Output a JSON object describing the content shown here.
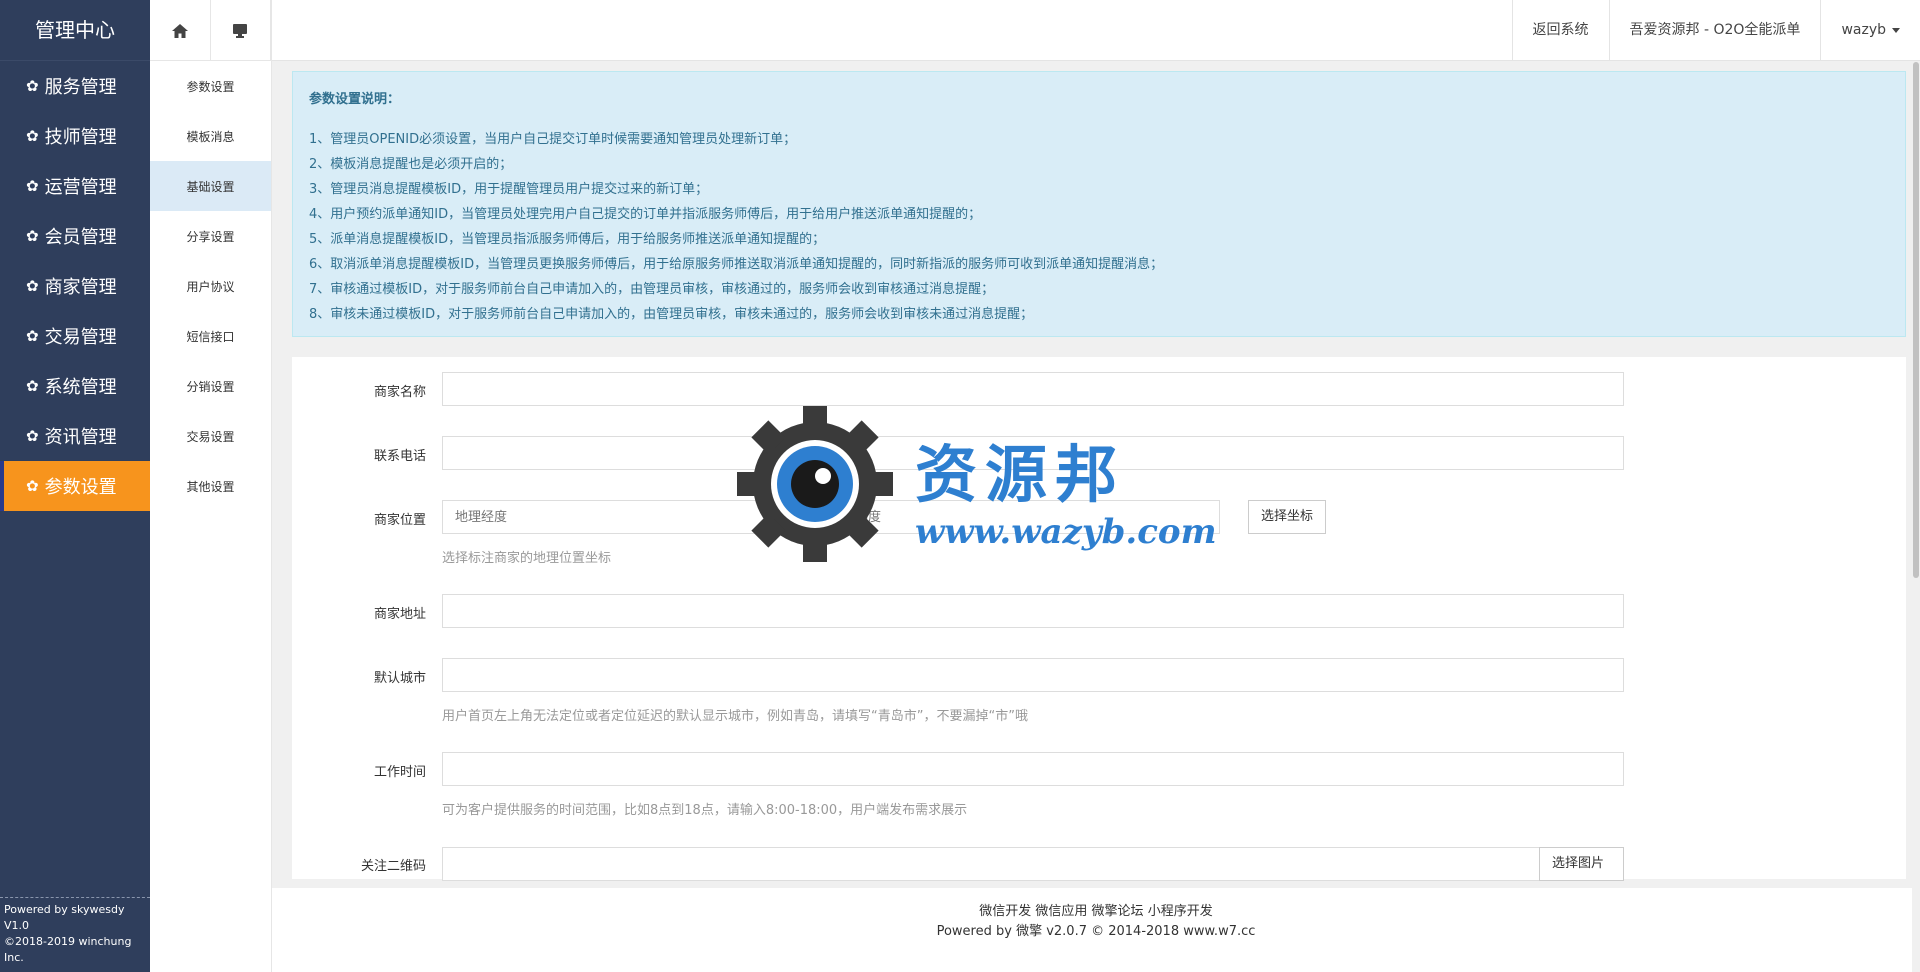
{
  "sidebar": {
    "brand": "管理中心",
    "items": [
      {
        "label": "服务管理"
      },
      {
        "label": "技师管理"
      },
      {
        "label": "运营管理"
      },
      {
        "label": "会员管理"
      },
      {
        "label": "商家管理"
      },
      {
        "label": "交易管理"
      },
      {
        "label": "系统管理"
      },
      {
        "label": "资讯管理"
      },
      {
        "label": "参数设置",
        "active": true
      }
    ],
    "powered_line1": "Powered by skywesdy V1.0",
    "powered_line2": "©2018-2019 winchung Inc."
  },
  "subnav": {
    "items": [
      {
        "label": "参数设置"
      },
      {
        "label": "模板消息"
      },
      {
        "label": "基础设置",
        "active": true
      },
      {
        "label": "分享设置"
      },
      {
        "label": "用户协议"
      },
      {
        "label": "短信接口"
      },
      {
        "label": "分销设置"
      },
      {
        "label": "交易设置"
      },
      {
        "label": "其他设置"
      }
    ]
  },
  "topbar": {
    "back": "返回系统",
    "app": "吾爱资源邦 - O2O全能派单",
    "user": "wazyb"
  },
  "notice": {
    "title": "参数设置说明：",
    "lines": [
      "1、管理员OPENID必须设置，当用户自己提交订单时候需要通知管理员处理新订单；",
      "2、模板消息提醒也是必须开启的；",
      "3、管理员消息提醒模板ID，用于提醒管理员用户提交过来的新订单；",
      "4、用户预约派单通知ID，当管理员处理完用户自己提交的订单并指派服务师傅后，用于给用户推送派单通知提醒的；",
      "5、派单消息提醒模板ID，当管理员指派服务师傅后，用于给服务师推送派单通知提醒的；",
      "6、取消派单消息提醒模板ID，当管理员更换服务师傅后，用于给原服务师推送取消派单通知提醒的，同时新指派的服务师可收到派单通知提醒消息；",
      "7、审核通过模板ID，对于服务师前台自己申请加入的，由管理员审核，审核通过的，服务师会收到审核通过消息提醒；",
      "8、审核未通过模板ID，对于服务师前台自己申请加入的，由管理员审核，审核未通过的，服务师会收到审核未通过消息提醒；"
    ]
  },
  "form": {
    "name_label": "商家名称",
    "phone_label": "联系电话",
    "location_label": "商家位置",
    "lng_placeholder": "地理经度",
    "lat_placeholder": "地理纬度",
    "pick_coord": "选择坐标",
    "location_help": "选择标注商家的地理位置坐标",
    "address_label": "商家地址",
    "city_label": "默认城市",
    "city_help": "用户首页左上角无法定位或者定位延迟的默认显示城市，例如青岛，请填写“青岛市”，不要漏掉“市”哦",
    "hours_label": "工作时间",
    "hours_help": "可为客户提供服务的时间范围，比如8点到18点，请输入8:00-18:00，用户端发布需求展示",
    "qrcode_label": "关注二维码",
    "pick_image": "选择图片"
  },
  "watermark": {
    "cn": "资源邦",
    "url": "www.wazyb.com"
  },
  "footer": {
    "links": "微信开发 微信应用 微擎论坛 小程序开发",
    "powered": "Powered by 微擎 v2.0.7 © 2014-2018 www.w7.cc"
  },
  "colors": {
    "sidebar_bg": "#2f3e5c",
    "active_orange": "#f7941d",
    "notice_bg": "#d9edf7",
    "notice_text": "#31708f",
    "watermark_blue": "#2e7fd0"
  }
}
